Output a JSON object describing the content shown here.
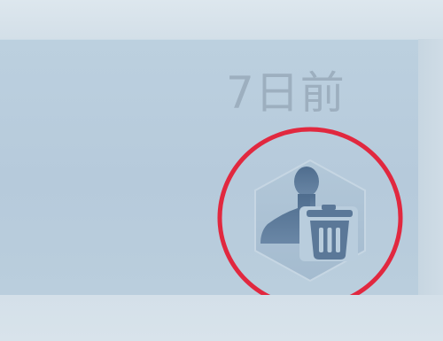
{
  "item": {
    "time_ago": "7日前"
  },
  "delete_button": {
    "icon": "delete-user-icon"
  },
  "highlight": {
    "color": "#e1283f"
  },
  "colors": {
    "card_bg": "#b8ccdc",
    "icon_body": "#5b7898",
    "hex_bg": "#a9c0d3",
    "time_text": "#9dafbf"
  }
}
